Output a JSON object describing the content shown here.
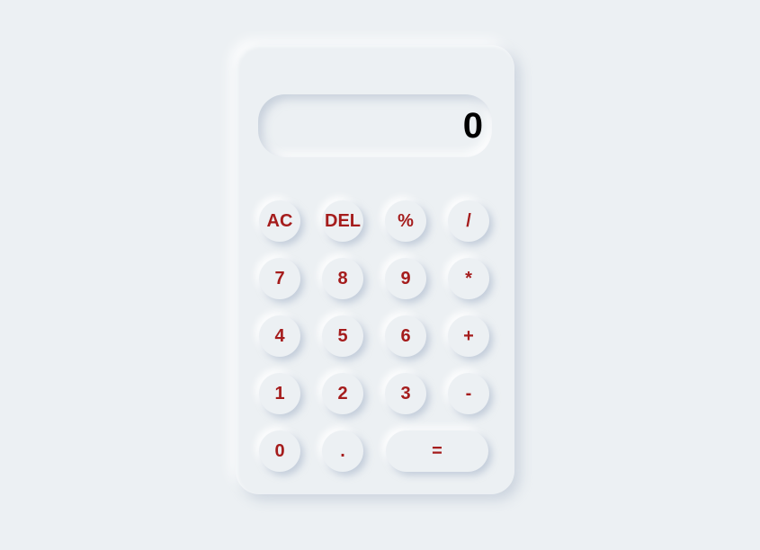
{
  "display": {
    "value": "0"
  },
  "colors": {
    "background": "#ecf0f3",
    "key_text": "#a51c1c",
    "display_text": "#000000"
  },
  "keys": {
    "ac": "AC",
    "del": "DEL",
    "percent": "%",
    "divide": "/",
    "seven": "7",
    "eight": "8",
    "nine": "9",
    "multiply": "*",
    "four": "4",
    "five": "5",
    "six": "6",
    "plus": "+",
    "one": "1",
    "two": "2",
    "three": "3",
    "minus": "-",
    "zero": "0",
    "decimal": ".",
    "equals": "="
  }
}
